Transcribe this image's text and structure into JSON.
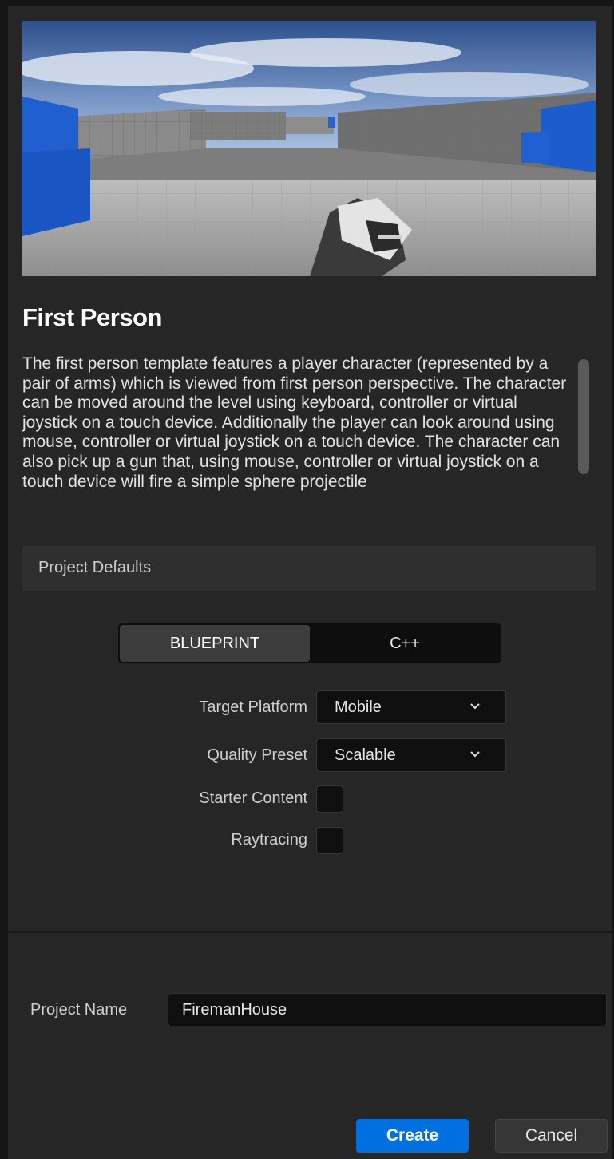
{
  "template": {
    "title": "First Person",
    "description": "The first person template features a player character (represented by a pair of arms) which is viewed from first person perspective. The character can be moved around the level using keyboard, controller or virtual joystick on a touch device. Additionally the player can look around using mouse, controller or virtual joystick on a touch device. The character can also pick up a gun that, using mouse, controller or virtual joystick on a touch device will fire a simple sphere projectile"
  },
  "project_defaults": {
    "section_label": "Project Defaults",
    "code_type": {
      "options": [
        "BLUEPRINT",
        "C++"
      ],
      "selected": "BLUEPRINT"
    },
    "target_platform": {
      "label": "Target Platform",
      "value": "Mobile"
    },
    "quality_preset": {
      "label": "Quality Preset",
      "value": "Scalable"
    },
    "starter_content": {
      "label": "Starter Content",
      "checked": false
    },
    "raytracing": {
      "label": "Raytracing",
      "checked": false
    }
  },
  "project": {
    "name_label": "Project Name",
    "name_value": "FiremanHouse"
  },
  "actions": {
    "create_label": "Create",
    "cancel_label": "Cancel"
  },
  "colors": {
    "accent": "#0070e0",
    "panel": "#262626",
    "input": "#0f0f0f"
  }
}
